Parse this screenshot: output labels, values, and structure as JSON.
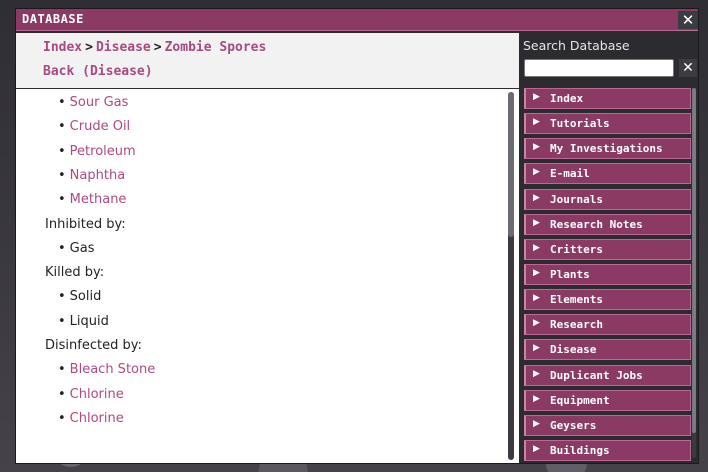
{
  "window": {
    "title": "DATABASE",
    "close_glyph": "✕"
  },
  "breadcrumb": {
    "items": [
      "Index",
      "Disease",
      "Zombie Spores"
    ],
    "separator": ">"
  },
  "back_link": "Back (Disease)",
  "entry": {
    "lines": [
      {
        "kind": "link",
        "text": "Sour Gas"
      },
      {
        "kind": "link",
        "text": "Crude Oil"
      },
      {
        "kind": "link",
        "text": "Petroleum"
      },
      {
        "kind": "link",
        "text": "Naphtha"
      },
      {
        "kind": "link",
        "text": "Methane"
      },
      {
        "kind": "heading",
        "text": "Inhibited by:"
      },
      {
        "kind": "plain",
        "text": "Gas"
      },
      {
        "kind": "heading",
        "text": "Killed by:"
      },
      {
        "kind": "plain",
        "text": "Solid"
      },
      {
        "kind": "plain",
        "text": "Liquid"
      },
      {
        "kind": "heading",
        "text": "Disinfected by:"
      },
      {
        "kind": "link",
        "text": "Bleach Stone"
      },
      {
        "kind": "link",
        "text": "Chlorine"
      },
      {
        "kind": "link",
        "text": "Chlorine"
      }
    ],
    "bullet": "•"
  },
  "search": {
    "label": "Search Database",
    "value": "",
    "placeholder": "",
    "clear_glyph": "✕"
  },
  "categories": [
    "Index",
    "Tutorials",
    "My Investigations",
    "E-mail",
    "Journals",
    "Research Notes",
    "Critters",
    "Plants",
    "Elements",
    "Research",
    "Disease",
    "Duplicant Jobs",
    "Equipment",
    "Geysers",
    "Buildings"
  ],
  "icons": {
    "category_arrow": "play-arrow-icon",
    "close": "close-icon"
  },
  "colors": {
    "accent": "#8a3a63",
    "link": "#b04883",
    "panel": "#2b2b30"
  }
}
